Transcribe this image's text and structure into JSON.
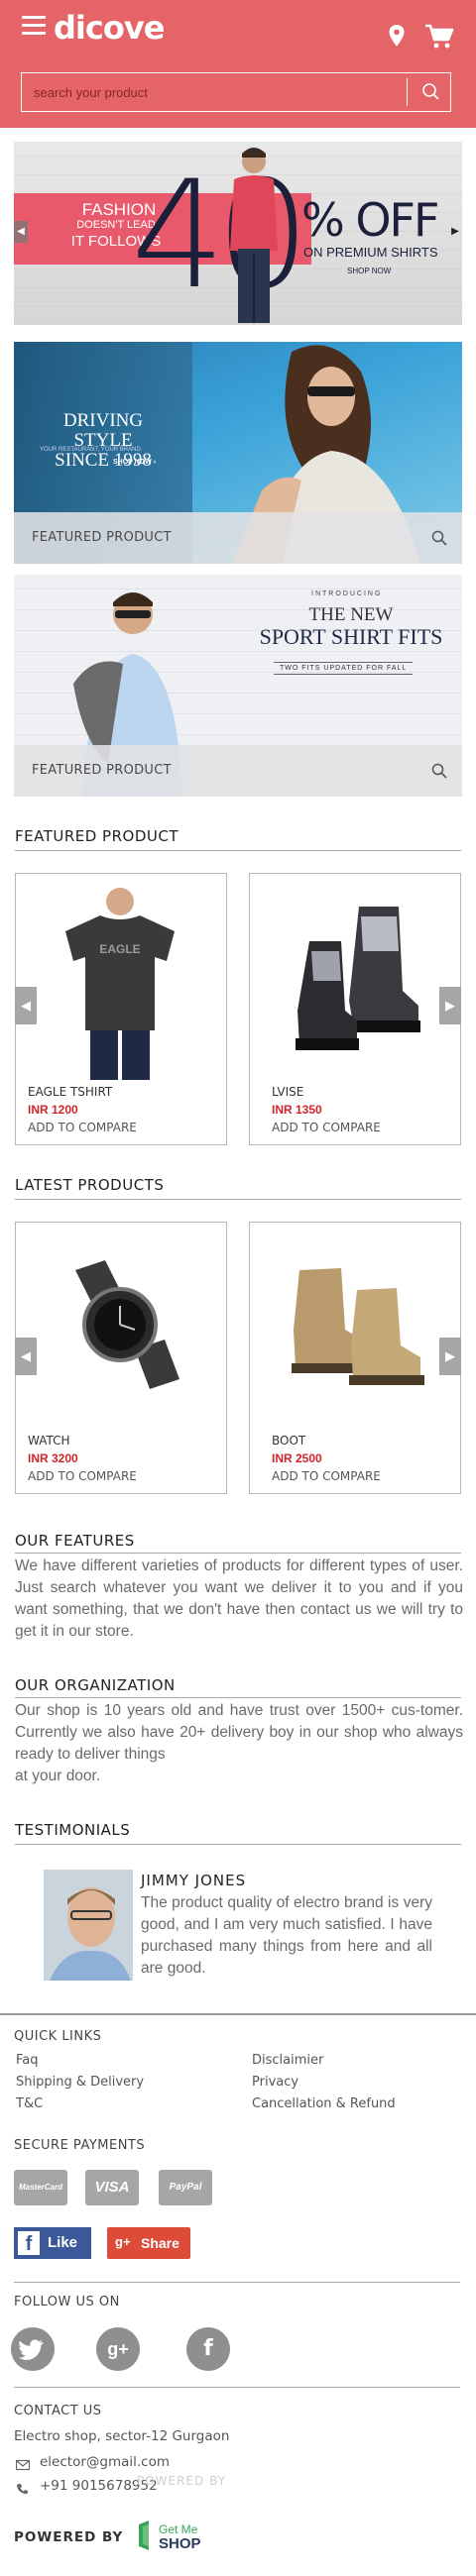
{
  "header": {
    "logo": "dicove",
    "search_placeholder": "search your product"
  },
  "banners": {
    "banner1": {
      "line1": "FASHION",
      "line2": "DOESN'T LEAD",
      "line3": "IT FOLLOWS",
      "big_number": "40",
      "off": "% OFF",
      "sub": "ON PREMIUM SHIRTS",
      "shop": "SHOP NOW"
    },
    "banner2": {
      "line1": "DRIVING STYLE",
      "line2": "SINCE 1998",
      "small": "YOUR RESTAURANT, YOUR BRAND",
      "shop": "SHOP NOW ›",
      "caption": "FEATURED PRODUCT"
    },
    "banner3": {
      "intro": "INTRODUCING",
      "title1": "THE NEW",
      "title2": "SPORT SHIRT FITS",
      "sub": "TWO FITS UPDATED FOR FALL",
      "caption": "FEATURED PRODUCT"
    }
  },
  "featured": {
    "title": "FEATURED PRODUCT",
    "items": [
      {
        "name": "EAGLE TSHIRT",
        "price": "INR 1200",
        "compare": "ADD TO COMPARE",
        "print": "EAGLE"
      },
      {
        "name": "LVISE",
        "price": "INR 1350",
        "compare": "ADD TO COMPARE"
      }
    ]
  },
  "latest": {
    "title": "LATEST PRODUCTS",
    "items": [
      {
        "name": "WATCH",
        "price": "INR 3200",
        "compare": "ADD TO COMPARE"
      },
      {
        "name": "BOOT",
        "price": "INR 2500",
        "compare": "ADD TO COMPARE"
      }
    ]
  },
  "features": {
    "title": "OUR FEATURES",
    "text": "We have different varieties of products for different types of user. Just search whatever you want we deliver it to you and if you want something, that we don't have then contact us we will try to get it in our store."
  },
  "organization": {
    "title": "OUR ORGANIZATION",
    "text1": "Our shop is 10 years old and have trust over 1500+ cus-tomer. Currently we also have 20+ delivery boy in our shop who always ready to deliver things",
    "text2": "at your door."
  },
  "testimonials": {
    "title": "TESTIMONIALS",
    "name": "JIMMY JONES",
    "text": "The product quality of electro brand is very good, and I am very much satisfied. I have purchased many things from here and all are good."
  },
  "footer": {
    "quick_links_title": "QUICK LINKS",
    "links": [
      "Faq",
      "Disclaimier",
      "Shipping & Delivery",
      "Privacy",
      "T&C",
      "Cancellation & Refund"
    ],
    "secure_title": "SECURE PAYMENTS",
    "payments": [
      "MasterCard",
      "VISA",
      "PayPal"
    ],
    "like": "Like",
    "share": "Share",
    "follow_title": "FOLLOW US ON",
    "contact_title": "CONTACT US",
    "address": "Electro shop, sector-12 Gurgaon",
    "email": "elector@gmail.com",
    "phone": "+91 9015678952",
    "powered_ghost": "POWERED BY",
    "powered": "POWERED BY",
    "brand_top": "Get Me",
    "brand_bottom": "SHOP"
  },
  "colors": {
    "accent": "#e56467",
    "price": "#d2232a"
  }
}
